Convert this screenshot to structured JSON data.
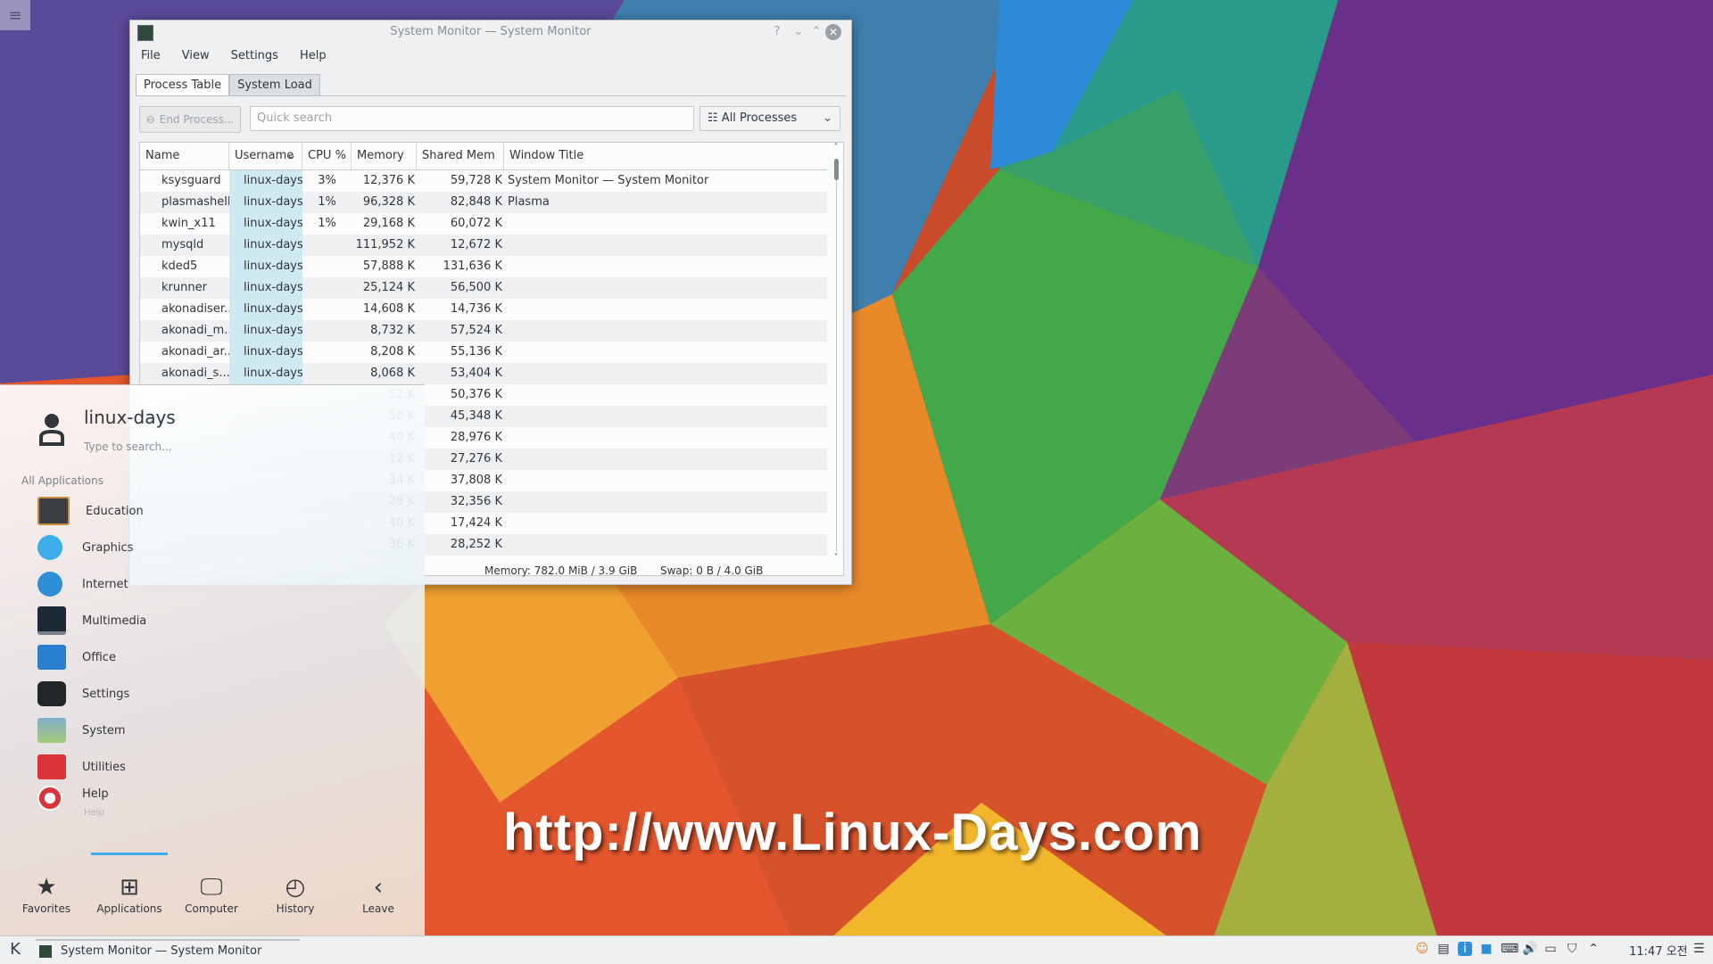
{
  "window": {
    "title": "System Monitor — System Monitor",
    "menu": [
      "File",
      "View",
      "Settings",
      "Help"
    ],
    "tabs": [
      "Process Table",
      "System Load"
    ],
    "end_process_label": "End Process...",
    "search_placeholder": "Quick search",
    "filter_value": "All Processes",
    "columns": [
      "Name",
      "Username",
      "CPU %",
      "Memory",
      "Shared Mem",
      "Window Title"
    ],
    "rows": [
      {
        "name": "ksysguard",
        "user": "linux-days",
        "cpu": "3%",
        "mem": "12,376 K",
        "shared": "59,728 K",
        "title": "System Monitor — System Monitor"
      },
      {
        "name": "plasmashell",
        "user": "linux-days",
        "cpu": "1%",
        "mem": "96,328 K",
        "shared": "82,848 K",
        "title": "Plasma"
      },
      {
        "name": "kwin_x11",
        "user": "linux-days",
        "cpu": "1%",
        "mem": "29,168 K",
        "shared": "60,072 K",
        "title": ""
      },
      {
        "name": "mysqld",
        "user": "linux-days",
        "cpu": "",
        "mem": "111,952 K",
        "shared": "12,672 K",
        "title": ""
      },
      {
        "name": "kded5",
        "user": "linux-days",
        "cpu": "",
        "mem": "57,888 K",
        "shared": "131,636 K",
        "title": ""
      },
      {
        "name": "krunner",
        "user": "linux-days",
        "cpu": "",
        "mem": "25,124 K",
        "shared": "56,500 K",
        "title": ""
      },
      {
        "name": "akonadiser...",
        "user": "linux-days",
        "cpu": "",
        "mem": "14,608 K",
        "shared": "14,736 K",
        "title": ""
      },
      {
        "name": "akonadi_m...",
        "user": "linux-days",
        "cpu": "",
        "mem": "8,732 K",
        "shared": "57,524 K",
        "title": ""
      },
      {
        "name": "akonadi_ar...",
        "user": "linux-days",
        "cpu": "",
        "mem": "8,208 K",
        "shared": "55,136 K",
        "title": ""
      },
      {
        "name": "akonadi_s...",
        "user": "linux-days",
        "cpu": "",
        "mem": "8,068 K",
        "shared": "53,404 K",
        "title": ""
      },
      {
        "name": "",
        "user": "",
        "cpu": "",
        "mem": "52 K",
        "shared": "50,376 K",
        "title": ""
      },
      {
        "name": "",
        "user": "",
        "cpu": "",
        "mem": "58 K",
        "shared": "45,348 K",
        "title": ""
      },
      {
        "name": "",
        "user": "",
        "cpu": "",
        "mem": "40 K",
        "shared": "28,976 K",
        "title": ""
      },
      {
        "name": "",
        "user": "",
        "cpu": "",
        "mem": "12 K",
        "shared": "27,276 K",
        "title": ""
      },
      {
        "name": "",
        "user": "",
        "cpu": "",
        "mem": "34 K",
        "shared": "37,808 K",
        "title": ""
      },
      {
        "name": "",
        "user": "",
        "cpu": "",
        "mem": "28 K",
        "shared": "32,356 K",
        "title": ""
      },
      {
        "name": "",
        "user": "",
        "cpu": "",
        "mem": "40 K",
        "shared": "17,424 K",
        "title": ""
      },
      {
        "name": "",
        "user": "",
        "cpu": "",
        "mem": "36 K",
        "shared": "28,252 K",
        "title": ""
      }
    ],
    "status_memory": "Memory: 782.0 MiB / 3.9 GiB",
    "status_swap": "Swap: 0 B / 4.0 GiB"
  },
  "launcher": {
    "user": "linux-days",
    "search_hint": "Type to search...",
    "section": "All Applications",
    "categories": [
      "Education",
      "Graphics",
      "Internet",
      "Multimedia",
      "Office",
      "Settings",
      "System",
      "Utilities",
      "Help"
    ],
    "help_sub": "Help",
    "nav": [
      "Favorites",
      "Applications",
      "Computer",
      "History",
      "Leave"
    ]
  },
  "watermark": "http://www.Linux-Days.com",
  "taskbar": {
    "task_title": "System Monitor — System Monitor",
    "clock": "11:47 오전"
  },
  "colors": {
    "accent": "#3daee9",
    "user_col": "#cfe9f1"
  }
}
